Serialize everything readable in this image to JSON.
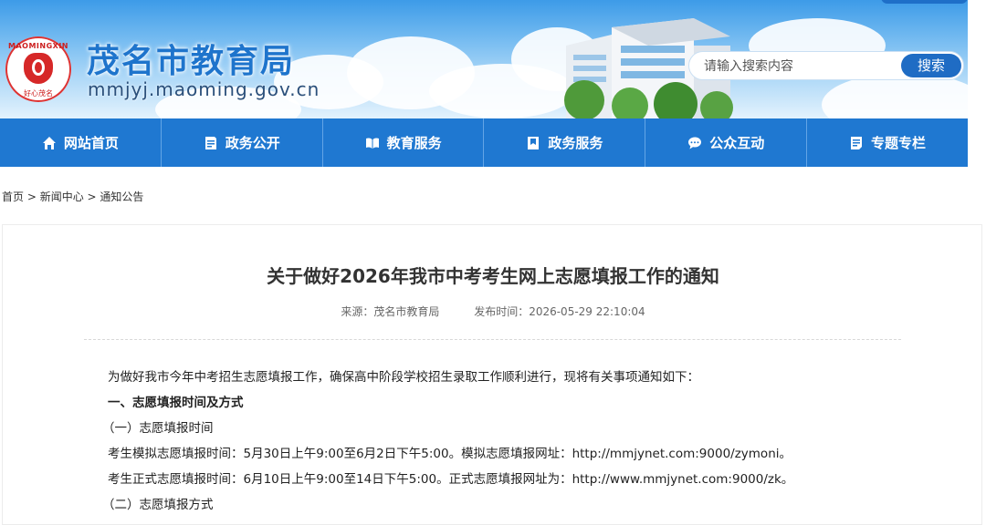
{
  "header": {
    "logo_ring_text": "MAOMINGXIN",
    "logo_sub_text": "好心茂名",
    "site_title": "茂名市教育局",
    "site_domain": "mmjyj.maoming.gov.cn",
    "search": {
      "placeholder": "请输入搜索内容",
      "button_label": "搜索"
    }
  },
  "nav": {
    "items": [
      {
        "label": "网站首页",
        "icon": "home-icon"
      },
      {
        "label": "政务公开",
        "icon": "document-icon"
      },
      {
        "label": "教育服务",
        "icon": "book-icon"
      },
      {
        "label": "政务服务",
        "icon": "bookmark-icon"
      },
      {
        "label": "公众互动",
        "icon": "chat-icon"
      },
      {
        "label": "专题专栏",
        "icon": "list-icon"
      }
    ]
  },
  "breadcrumb": {
    "items": [
      "首页",
      "新闻中心",
      "通知公告"
    ],
    "separator": " > "
  },
  "article": {
    "title": "关于做好2026年我市中考考生网上志愿填报工作的通知",
    "source": "来源：茂名市教育局",
    "publish_time": "发布时间：2026-05-29 22:10:04",
    "paragraphs": [
      "为做好我市今年中考招生志愿填报工作，确保高中阶段学校招生录取工作顺利进行，现将有关事项通知如下：",
      "一、志愿填报时间及方式",
      "（一）志愿填报时间",
      "考生模拟志愿填报时间：5月30日上午9:00至6月2日下午5:00。模拟志愿填报网址：http://mmjynet.com:9000/zymoni。",
      "考生正式志愿填报时间：6月10日上午9:00至14日下午5:00。正式志愿填报网址为：http://www.mmjynet.com:9000/zk。",
      "（二）志愿填报方式"
    ]
  },
  "colors": {
    "nav_bg": "#1f78d1",
    "title_blue": "#1e74cc",
    "search_button": "#1f6cc4"
  }
}
